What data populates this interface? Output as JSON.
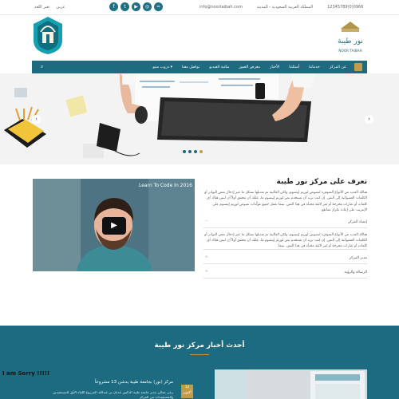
{
  "topbar": {
    "lang_label": "تغير اللغة",
    "lang_value": "عربي",
    "location": "المملكة العربية السعودية - المدينة",
    "email": "info@noortaibah.com",
    "phone": "0966(0)12345789"
  },
  "nav": {
    "items": [
      "عن المركز",
      "خدماتنا",
      "أسئلتنا",
      "الأخبار",
      "معرض الصور",
      "مكتبة الفيديو",
      "تواصل معنا",
      "دروب منيو ▾"
    ]
  },
  "hero": {
    "active_dot": 4
  },
  "video": {
    "title": "Learn To Code In 2016"
  },
  "about": {
    "heading": "تعرف على مركز نور طيبة",
    "intro": "هنالك العديد من الأنواع المتوفرة لنصوص لوريم إيبسوم، ولكن الغالبية تم تعديلها بشكل ما عبر إدخال بعض النوادر أو الكلمات العشوائية إلى النص. إن كنت تريد أن تستخدم نص لوريم إيبسوم ما، عليك أن تتحقق أولاً أن ليس هناك أي كلمات أو عبارات محرجة أو غير لائقة مخبأة في هذا النص. بينما تعمل جميع مولّدات نصوص لوريم إيبسوم على الإنترنت على إعادة تكرار مقاطع",
    "accordion": [
      {
        "label": "إنشاء المركز",
        "text": "هنالك العديد من الأنواع المتوفرة لنصوص لوريم إيبسوم، ولكن الغالبية تم تعديلها بشكل ما عبر إدخال بعض النوادر أو الكلمات العشوائية إلى النص. إن كنت تريد أن تستخدم نص لوريم إيبسوم ما، عليك أن تتحقق أولاً أن ليس هناك أي كلمات أو عبارات محرجة أو غير لائقة مخبأة في هذا النص. بينما"
      },
      {
        "label": "مدير المركز"
      },
      {
        "label": "الرسالة والرؤية"
      }
    ]
  },
  "news": {
    "heading": "أحدث أخبار مركز نور طيبة",
    "item_title": "مركز (نور) بجامعة طيبة يدشن 13 مشروعاً",
    "item_text": "رعى معالي مدير جامعة طيبة الدكتور عدنان بن عبدالله المزروع اللقاء الأول للمستفيدين والمستفيدات من المركز",
    "date_day": "12",
    "date_month": "أكتوبر"
  },
  "watermark": "I am Sorry !!!!!",
  "colors": {
    "primary": "#1e6b7f",
    "accent": "#c39a48"
  },
  "logos": {
    "right_text": "نور طيبة",
    "right_sub": "NOOR TAIBAH"
  }
}
